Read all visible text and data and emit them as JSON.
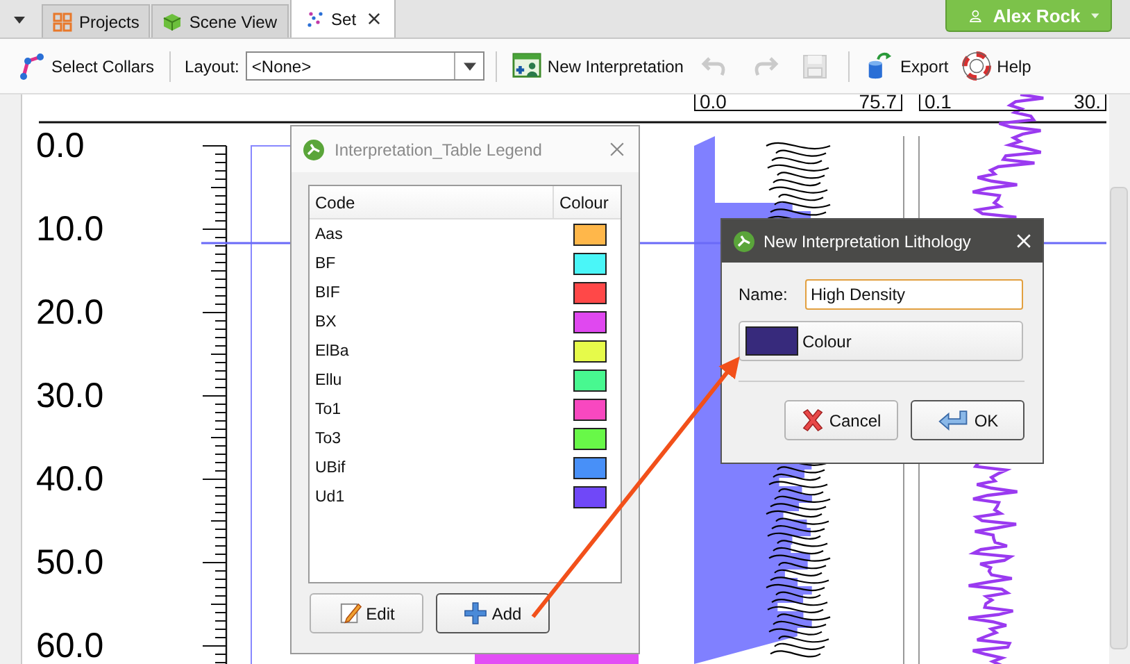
{
  "tab_bar": {
    "tabs": [
      {
        "label": "Projects",
        "selected": false
      },
      {
        "label": "Scene View",
        "selected": false
      },
      {
        "label": "Set",
        "selected": true
      }
    ],
    "user": "Alex Rock"
  },
  "toolbar": {
    "items": [
      {
        "kind": "button",
        "label": "Select Collars",
        "disabled": false
      },
      {
        "kind": "separator"
      },
      {
        "kind": "dropdown",
        "label": "Layout:",
        "value": "<None>"
      },
      {
        "kind": "separator"
      },
      {
        "kind": "button",
        "label": "New Interpretation",
        "disabled": false
      },
      {
        "kind": "icon",
        "disabled": true
      },
      {
        "kind": "icon",
        "disabled": true
      },
      {
        "kind": "icon",
        "disabled": true
      },
      {
        "kind": "separator"
      },
      {
        "kind": "button",
        "label": "Export",
        "disabled": false
      },
      {
        "kind": "button",
        "label": "Help",
        "disabled": false
      }
    ]
  },
  "log_view": {
    "header_ranges": [
      {
        "min": "0.0",
        "max": "75.7"
      },
      {
        "min": "0.1",
        "max": "30."
      }
    ],
    "depth_labels": [
      "0.0",
      "10.0",
      "20.0",
      "30.0",
      "40.0",
      "50.0",
      "60.0"
    ]
  },
  "legend_dialog": {
    "title": "Interpretation_Table Legend",
    "columns": [
      "Code",
      "Colour"
    ],
    "rows": [
      {
        "code": "Aas",
        "color": "#ffb74a"
      },
      {
        "code": "BF",
        "color": "#4af6f8"
      },
      {
        "code": "BIF",
        "color": "#ff4848"
      },
      {
        "code": "BX",
        "color": "#e048f0"
      },
      {
        "code": "ElBa",
        "color": "#e6fa4a"
      },
      {
        "code": "Ellu",
        "color": "#48f890"
      },
      {
        "code": "To1",
        "color": "#f848c0"
      },
      {
        "code": "To3",
        "color": "#68f848"
      },
      {
        "code": "UBif",
        "color": "#4890f8"
      },
      {
        "code": "Ud1",
        "color": "#7048f8"
      }
    ],
    "buttons": [
      "Edit",
      "Add"
    ]
  },
  "lithology_dialog": {
    "title": "New Interpretation Lithology",
    "name_label": "Name:",
    "name_value": "High Density",
    "colour_label": "Colour",
    "color": "#372a7c",
    "buttons": [
      "Cancel",
      "OK"
    ]
  }
}
